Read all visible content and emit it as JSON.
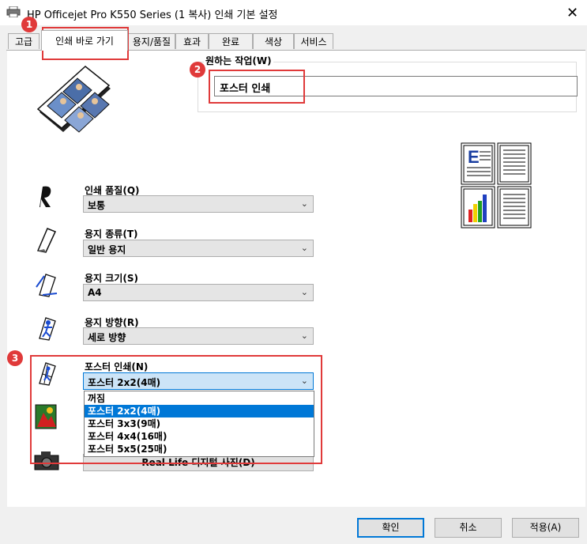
{
  "window": {
    "title": "HP Officejet Pro K550 Series (1 복사) 인쇄 기본 설정",
    "close_glyph": "✕"
  },
  "tabs": [
    {
      "label": "고급",
      "active": false
    },
    {
      "label": "인쇄 바로 가기",
      "active": true
    },
    {
      "label": "용지/품질",
      "active": false
    },
    {
      "label": "효과",
      "active": false
    },
    {
      "label": "완료",
      "active": false
    },
    {
      "label": "색상",
      "active": false
    },
    {
      "label": "서비스",
      "active": false
    }
  ],
  "task": {
    "label": "원하는 작업(W)",
    "value": "포스터 인쇄"
  },
  "settings": {
    "print_quality": {
      "label": "인쇄 품질(Q)",
      "value": "보통"
    },
    "paper_type": {
      "label": "용지 종류(T)",
      "value": "일반 용지"
    },
    "paper_size": {
      "label": "용지 크기(S)",
      "value": "A4"
    },
    "orientation": {
      "label": "용지 방향(R)",
      "value": "세로 방향"
    },
    "poster": {
      "label": "포스터 인쇄(N)",
      "value": "포스터 2x2(4매)",
      "options": [
        "꺼짐",
        "포스터 2x2(4매)",
        "포스터 3x3(9매)",
        "포스터 4x4(16매)",
        "포스터 5x5(25매)"
      ],
      "selected_index": 1
    },
    "reallife_label": "Real Life 디지털 사진(D)"
  },
  "annotations": [
    "1",
    "2",
    "3"
  ],
  "buttons": {
    "ok": "확인",
    "cancel": "취소",
    "apply": "적용(A)"
  },
  "colors": {
    "highlight": "#e03a3a",
    "selection": "#0078d7"
  }
}
